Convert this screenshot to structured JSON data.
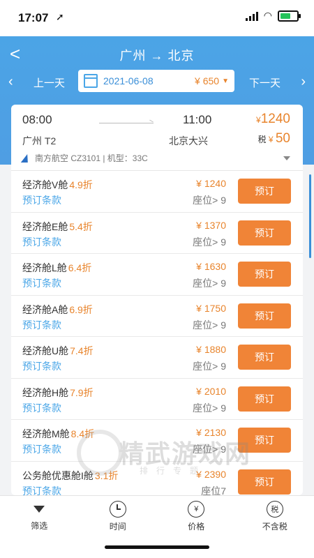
{
  "status": {
    "time": "17:07"
  },
  "nav": {
    "route": "广州 → 北京"
  },
  "daybar": {
    "prev": "上一天",
    "next": "下一天",
    "date": "2021-06-08",
    "price": "¥ 650"
  },
  "flight": {
    "dep_time": "08:00",
    "arr_time": "11:00",
    "dep_airport": "广州 T2",
    "arr_airport": "北京大兴",
    "price_symbol": "¥",
    "price": "1240",
    "tax_label": "税",
    "tax_symbol": "¥",
    "tax": "50",
    "airline": "南方航空 CZ3101 | 机型：33C"
  },
  "book_label": "预订",
  "rule_label": "预订条款",
  "cabins": [
    {
      "name": "经济舱V舱",
      "discount": "4.9折",
      "price": "¥ 1240",
      "seats": "座位> 9"
    },
    {
      "name": "经济舱E舱",
      "discount": "5.4折",
      "price": "¥ 1370",
      "seats": "座位> 9"
    },
    {
      "name": "经济舱L舱",
      "discount": "6.4折",
      "price": "¥ 1630",
      "seats": "座位> 9"
    },
    {
      "name": "经济舱A舱",
      "discount": "6.9折",
      "price": "¥ 1750",
      "seats": "座位> 9"
    },
    {
      "name": "经济舱U舱",
      "discount": "7.4折",
      "price": "¥ 1880",
      "seats": "座位> 9"
    },
    {
      "name": "经济舱H舱",
      "discount": "7.9折",
      "price": "¥ 2010",
      "seats": "座位> 9"
    },
    {
      "name": "经济舱M舱",
      "discount": "8.4折",
      "price": "¥ 2130",
      "seats": "座位> 9"
    },
    {
      "name": "公务舱优惠舱I舱",
      "discount": "3.1折",
      "price": "¥ 2390",
      "seats": "座位7"
    }
  ],
  "tabs": [
    {
      "label": "筛选",
      "icon": "filter-icon"
    },
    {
      "label": "时间",
      "icon": "clock-icon"
    },
    {
      "label": "价格",
      "icon": "yuan-icon",
      "glyph": "¥"
    },
    {
      "label": "不含税",
      "icon": "tax-icon",
      "glyph": "税"
    }
  ],
  "watermark": {
    "title": "精武游戏网",
    "subtitle": "排行专题"
  },
  "colors": {
    "accent": "#4aa6e7",
    "orange": "#f08437",
    "price": "#e8842c"
  }
}
